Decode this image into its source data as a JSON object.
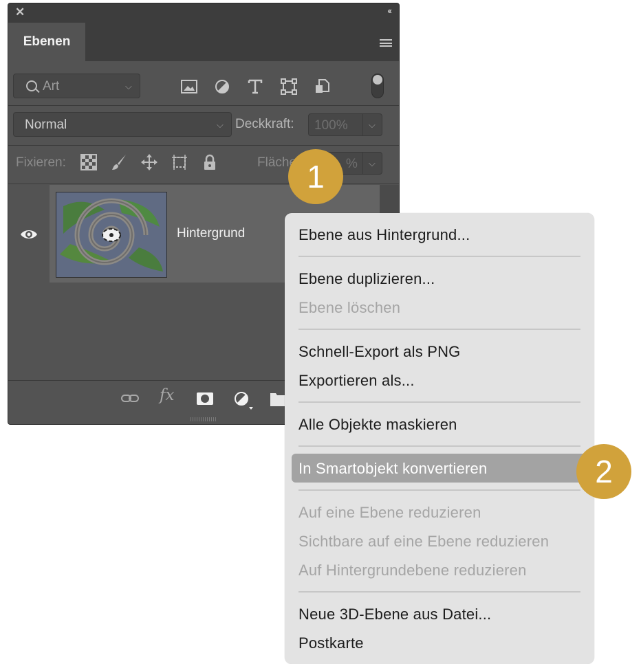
{
  "panel": {
    "tab_label": "Ebenen",
    "filter": {
      "placeholder": "Art"
    },
    "blend_mode": "Normal",
    "opacity_label": "Deckkraft:",
    "opacity_value": "100%",
    "lock_label": "Fixieren:",
    "fill_label": "Fläche",
    "fill_value": "%",
    "layers": [
      {
        "name": "Hintergrund",
        "visible": true
      }
    ],
    "filter_icons": [
      "image-icon",
      "adjustment-icon",
      "type-icon",
      "shape-icon",
      "smart-object-icon"
    ],
    "lock_icons": [
      "lock-transparency-icon",
      "lock-pixels-icon",
      "lock-position-icon",
      "lock-artboard-icon",
      "lock-all-icon"
    ],
    "footer_icons": [
      "link-icon",
      "fx-icon",
      "mask-icon",
      "adjustment-layer-icon",
      "group-folder-icon"
    ]
  },
  "context_menu": {
    "items": [
      {
        "label": "Ebene aus Hintergrund...",
        "enabled": true
      },
      {
        "label": "Ebene duplizieren...",
        "enabled": true
      },
      {
        "label": "Ebene löschen",
        "enabled": false
      },
      {
        "label": "Schnell-Export als PNG",
        "enabled": true
      },
      {
        "label": "Exportieren als...",
        "enabled": true
      },
      {
        "label": "Alle Objekte maskieren",
        "enabled": true
      },
      {
        "label": "In Smartobjekt konvertieren",
        "enabled": true,
        "highlighted": true
      },
      {
        "label": "Auf eine Ebene reduzieren",
        "enabled": false
      },
      {
        "label": "Sichtbare auf eine Ebene reduzieren",
        "enabled": false
      },
      {
        "label": "Auf Hintergrundebene reduzieren",
        "enabled": false
      },
      {
        "label": "Neue 3D-Ebene aus Datei...",
        "enabled": true
      },
      {
        "label": "Postkarte",
        "enabled": true
      }
    ]
  },
  "badges": [
    "1",
    "2"
  ],
  "colors": {
    "badge": "#d1a23b",
    "panel_bg": "#535353",
    "menu_bg": "#e3e3e3",
    "highlight": "#a3a3a3"
  }
}
